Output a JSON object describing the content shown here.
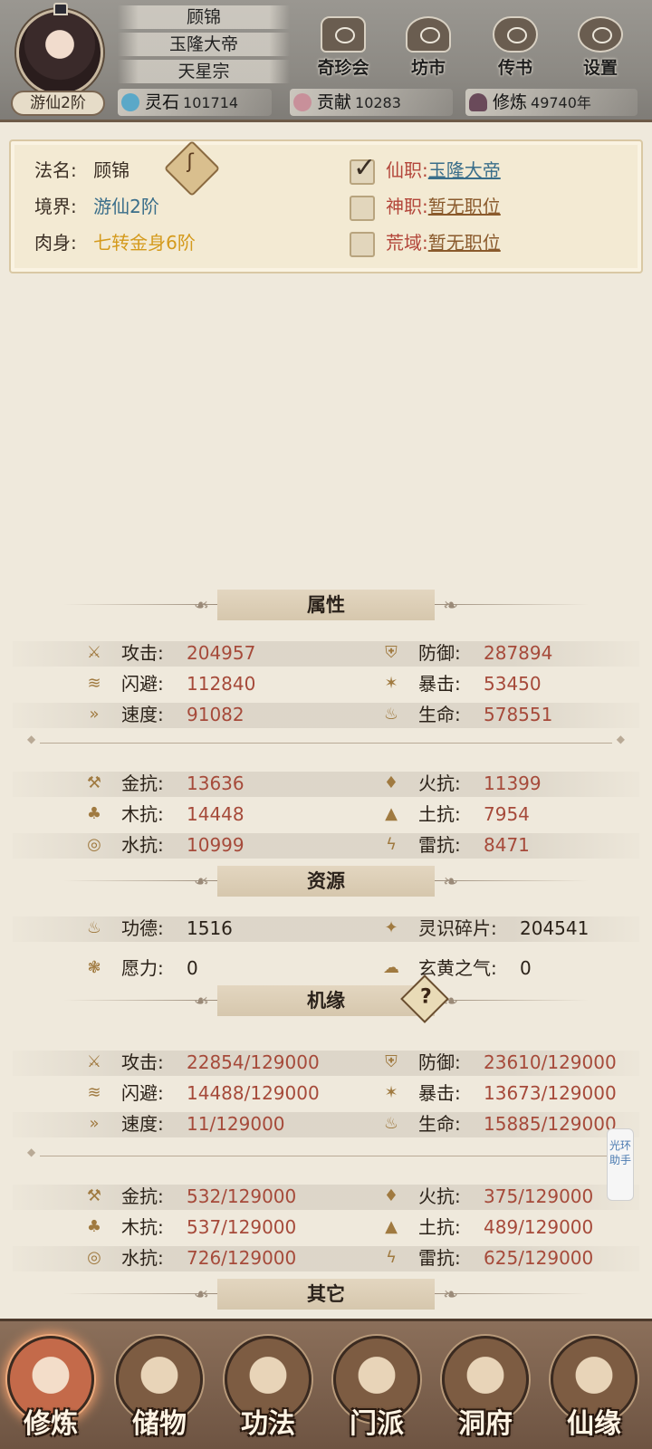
{
  "header": {
    "name": "顾锦",
    "title": "玉隆大帝",
    "sect": "天星宗",
    "realm": "游仙2阶",
    "buttons": [
      "奇珍会",
      "坊市",
      "传书",
      "设置"
    ],
    "resources": [
      {
        "label": "灵石",
        "value": "101714",
        "color": "#5aa8c8"
      },
      {
        "label": "贡献",
        "value": "10283",
        "color": "#c8909a"
      },
      {
        "label": "修炼",
        "value": "49740年",
        "color": "#6a4a5a"
      }
    ]
  },
  "info": {
    "dharma_name_label": "法名:",
    "dharma_name": "顾锦",
    "realm_label": "境界:",
    "realm": "游仙2阶",
    "body_label": "肉身:",
    "body": "七转金身6阶",
    "immortal_post_label": "仙职:",
    "immortal_post": "玉隆大帝",
    "divine_post_label": "神职:",
    "divine_post": "暂无职位",
    "wild_label": "荒域:",
    "wild": "暂无职位"
  },
  "sections": {
    "attributes": "属性",
    "resources": "资源",
    "fortune": "机缘",
    "other": "其它"
  },
  "attributes": {
    "attack": {
      "label": "攻击:",
      "value": "204957"
    },
    "defense": {
      "label": "防御:",
      "value": "287894"
    },
    "dodge": {
      "label": "闪避:",
      "value": "112840"
    },
    "crit": {
      "label": "暴击:",
      "value": "53450"
    },
    "speed": {
      "label": "速度:",
      "value": "91082"
    },
    "life": {
      "label": "生命:",
      "value": "578551"
    },
    "metal_res": {
      "label": "金抗:",
      "value": "13636"
    },
    "fire_res": {
      "label": "火抗:",
      "value": "11399"
    },
    "wood_res": {
      "label": "木抗:",
      "value": "14448"
    },
    "earth_res": {
      "label": "土抗:",
      "value": "7954"
    },
    "water_res": {
      "label": "水抗:",
      "value": "10999"
    },
    "thunder_res": {
      "label": "雷抗:",
      "value": "8471"
    }
  },
  "resources": {
    "merit": {
      "label": "功德:",
      "value": "1516"
    },
    "shards": {
      "label": "灵识碎片:",
      "value": "204541"
    },
    "wish": {
      "label": "愿力:",
      "value": "0"
    },
    "xuanhuang": {
      "label": "玄黄之气:",
      "value": "0"
    }
  },
  "fortune": {
    "attack": {
      "label": "攻击:",
      "value": "22854/129000"
    },
    "defense": {
      "label": "防御:",
      "value": "23610/129000"
    },
    "dodge": {
      "label": "闪避:",
      "value": "14488/129000"
    },
    "crit": {
      "label": "暴击:",
      "value": "13673/129000"
    },
    "speed": {
      "label": "速度:",
      "value": "11/129000"
    },
    "life": {
      "label": "生命:",
      "value": "15885/129000"
    },
    "metal_res": {
      "label": "金抗:",
      "value": "532/129000"
    },
    "fire_res": {
      "label": "火抗:",
      "value": "375/129000"
    },
    "wood_res": {
      "label": "木抗:",
      "value": "537/129000"
    },
    "earth_res": {
      "label": "土抗:",
      "value": "489/129000"
    },
    "water_res": {
      "label": "水抗:",
      "value": "726/129000"
    },
    "thunder_res": {
      "label": "雷抗:",
      "value": "625/129000"
    }
  },
  "side_tab": "光环助手",
  "nav": [
    "修炼",
    "储物",
    "功法",
    "门派",
    "洞府",
    "仙缘"
  ]
}
